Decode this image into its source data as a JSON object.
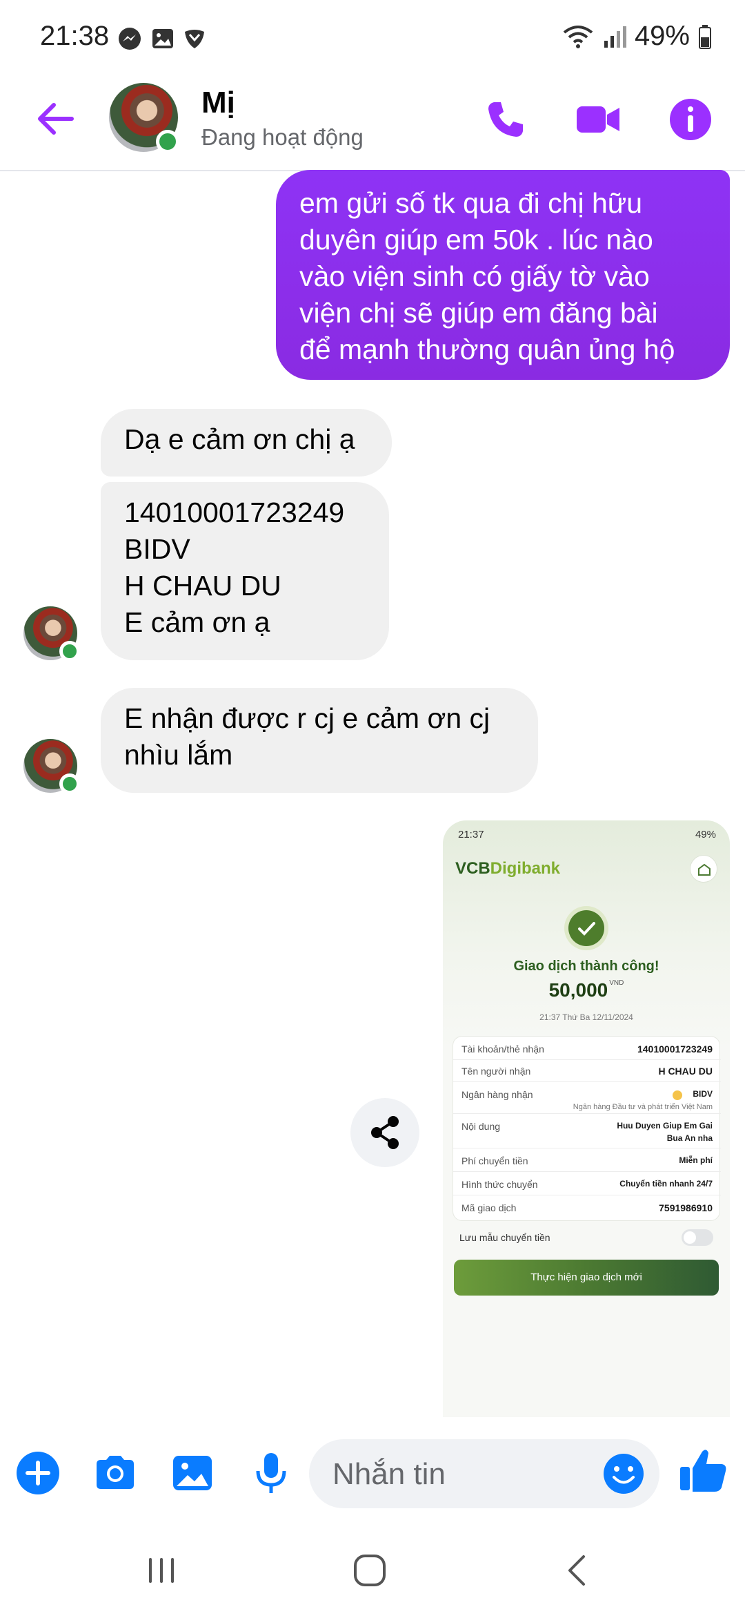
{
  "status_bar": {
    "time": "21:38",
    "battery": "49%"
  },
  "header": {
    "contact_name": "Mị",
    "contact_status": "Đang hoạt động"
  },
  "messages": {
    "outgoing_1": [
      "em gửi số tk qua đi chị hữu",
      "duyên giúp em 50k . lúc nào",
      "vào viện sinh có giấy tờ vào",
      "viện chị sẽ giúp em đăng bài",
      "để mạnh thường quân ủng hộ"
    ],
    "incoming_1": "Dạ e cảm ơn chị ạ",
    "incoming_2": [
      "14010001723249",
      "BIDV",
      "H CHAU DU",
      "E cảm ơn ạ"
    ],
    "incoming_3": [
      "E nhận được r cj e cảm ơn cj",
      "nhìu lắm"
    ]
  },
  "receipt": {
    "time": "21:37",
    "status_right": "49%",
    "logo_main": "VCB",
    "logo_sub": "Digibank",
    "success_text": "Giao dịch thành công!",
    "amount": "50,000",
    "currency": "VND",
    "datetime": "21:37 Thứ Ba 12/11/2024",
    "rows": [
      {
        "label": "Tài khoản/thẻ nhận",
        "value": "14010001723249"
      },
      {
        "label": "Tên người nhận",
        "value": "H CHAU DU"
      },
      {
        "label": "Ngân hàng nhận",
        "value": "BIDV",
        "sub": "Ngân hàng Đầu tư và phát triển Việt Nam"
      },
      {
        "label": "Nội dung",
        "value": "Huu Duyen Giup Em Gai",
        "value2": "Bua An nha"
      },
      {
        "label": "Phí chuyển tiền",
        "value": "Miễn phí"
      },
      {
        "label": "Hình thức chuyển",
        "value": "Chuyển tiền nhanh 24/7"
      },
      {
        "label": "Mã giao dịch",
        "value": "7591986910"
      }
    ],
    "save_template_label": "Lưu mẫu chuyển tiền",
    "new_transaction_label": "Thực hiện giao dịch mới"
  },
  "composer": {
    "placeholder": "Nhắn tin"
  },
  "colors": {
    "messenger_purple": "#8a2be2",
    "icon_purple": "#9b30ff",
    "composer_blue": "#0a7cff",
    "online_green": "#31a24c",
    "bubble_gray": "#f0f0f0",
    "vcb_green": "#2c5e1f"
  },
  "icons": {
    "status": [
      "messenger-icon",
      "gallery-icon",
      "shield-icon",
      "wifi-icon",
      "signal-icon",
      "battery-icon"
    ],
    "header": [
      "back-arrow-icon",
      "phone-icon",
      "video-icon",
      "info-icon"
    ],
    "composer": [
      "plus-icon",
      "camera-icon",
      "image-icon",
      "mic-icon",
      "emoji-icon",
      "thumbs-up-icon"
    ],
    "navbar": [
      "recent-apps-icon",
      "home-icon",
      "back-icon"
    ]
  }
}
